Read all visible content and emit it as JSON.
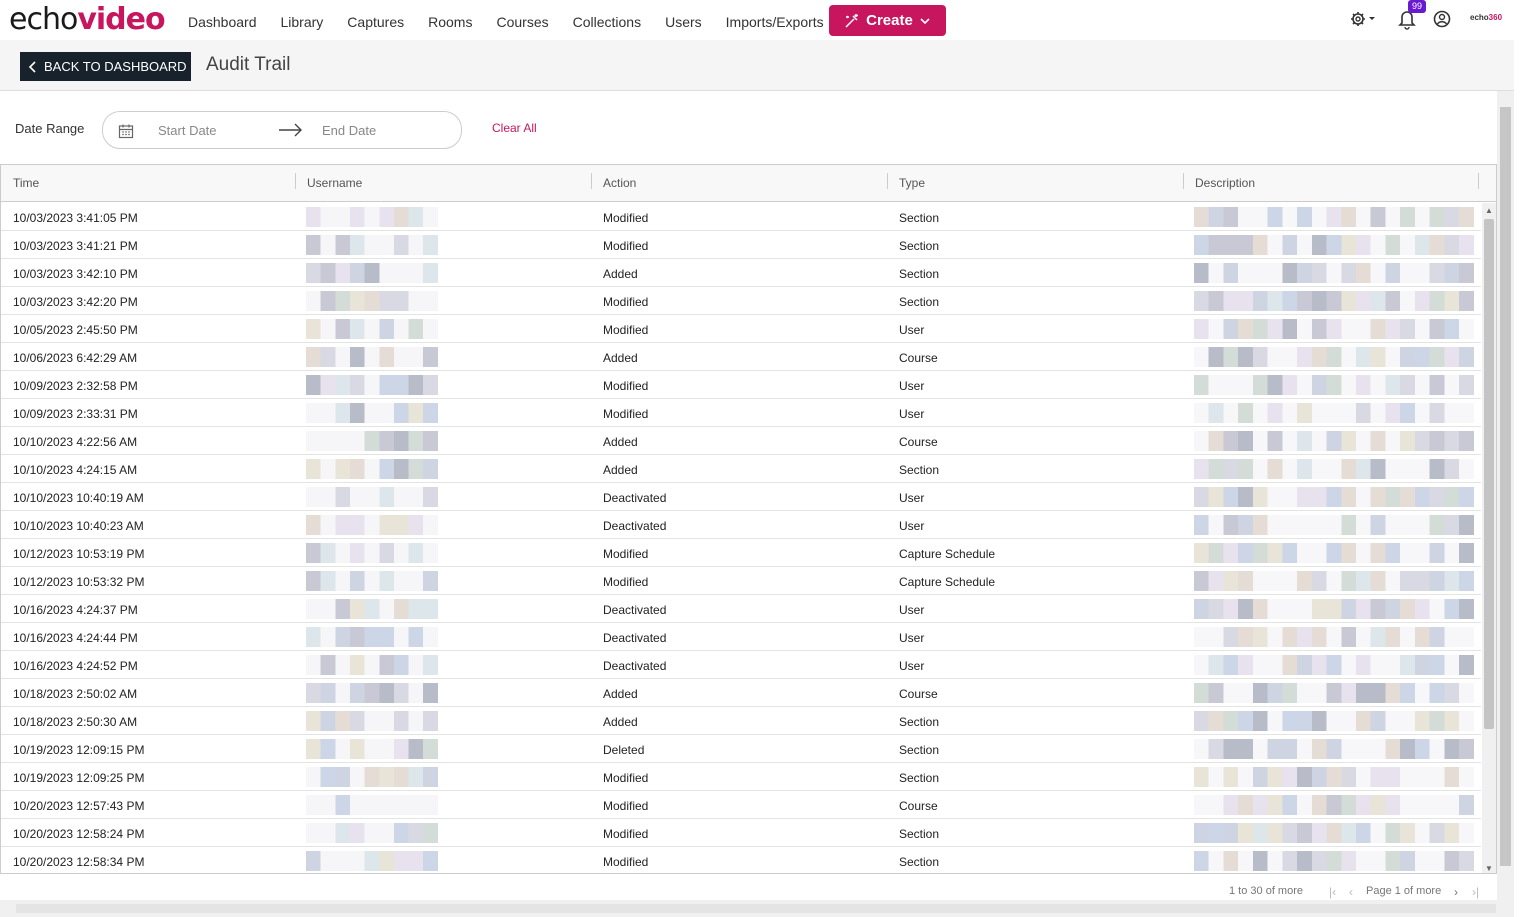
{
  "brand": {
    "echo": "echo",
    "video": "video",
    "echo360_a": "echo",
    "echo360_b": "360"
  },
  "nav": {
    "items": [
      "Dashboard",
      "Library",
      "Captures",
      "Rooms",
      "Courses",
      "Collections",
      "Users",
      "Imports/Exports"
    ],
    "create_label": "Create",
    "notification_count": "99"
  },
  "subheader": {
    "back_label": "BACK TO DASHBOARD",
    "title": "Audit Trail"
  },
  "filter": {
    "label": "Date Range",
    "start_placeholder": "Start Date",
    "end_placeholder": "End Date",
    "clear_label": "Clear All"
  },
  "table": {
    "columns": [
      "Time",
      "Username",
      "Action",
      "Type",
      "Description"
    ],
    "rows": [
      {
        "time": "10/03/2023 3:41:05 PM",
        "action": "Modified",
        "type": "Section"
      },
      {
        "time": "10/03/2023 3:41:21 PM",
        "action": "Modified",
        "type": "Section"
      },
      {
        "time": "10/03/2023 3:42:10 PM",
        "action": "Added",
        "type": "Section"
      },
      {
        "time": "10/03/2023 3:42:20 PM",
        "action": "Modified",
        "type": "Section"
      },
      {
        "time": "10/05/2023 2:45:50 PM",
        "action": "Modified",
        "type": "User"
      },
      {
        "time": "10/06/2023 6:42:29 AM",
        "action": "Added",
        "type": "Course"
      },
      {
        "time": "10/09/2023 2:32:58 PM",
        "action": "Modified",
        "type": "User"
      },
      {
        "time": "10/09/2023 2:33:31 PM",
        "action": "Modified",
        "type": "User"
      },
      {
        "time": "10/10/2023 4:22:56 AM",
        "action": "Added",
        "type": "Course"
      },
      {
        "time": "10/10/2023 4:24:15 AM",
        "action": "Added",
        "type": "Section"
      },
      {
        "time": "10/10/2023 10:40:19 AM",
        "action": "Deactivated",
        "type": "User"
      },
      {
        "time": "10/10/2023 10:40:23 AM",
        "action": "Deactivated",
        "type": "User"
      },
      {
        "time": "10/12/2023 10:53:19 PM",
        "action": "Modified",
        "type": "Capture Schedule"
      },
      {
        "time": "10/12/2023 10:53:32 PM",
        "action": "Modified",
        "type": "Capture Schedule"
      },
      {
        "time": "10/16/2023 4:24:37 PM",
        "action": "Deactivated",
        "type": "User"
      },
      {
        "time": "10/16/2023 4:24:44 PM",
        "action": "Deactivated",
        "type": "User"
      },
      {
        "time": "10/16/2023 4:24:52 PM",
        "action": "Deactivated",
        "type": "User"
      },
      {
        "time": "10/18/2023 2:50:02 AM",
        "action": "Added",
        "type": "Course"
      },
      {
        "time": "10/18/2023 2:50:30 AM",
        "action": "Added",
        "type": "Section"
      },
      {
        "time": "10/19/2023 12:09:15 PM",
        "action": "Deleted",
        "type": "Section"
      },
      {
        "time": "10/19/2023 12:09:25 PM",
        "action": "Modified",
        "type": "Section"
      },
      {
        "time": "10/20/2023 12:57:43 PM",
        "action": "Modified",
        "type": "Course"
      },
      {
        "time": "10/20/2023 12:58:24 PM",
        "action": "Modified",
        "type": "Section"
      },
      {
        "time": "10/20/2023 12:58:34 PM",
        "action": "Modified",
        "type": "Section"
      }
    ]
  },
  "pager": {
    "range": "1 to 30 of more",
    "page": "Page 1 of more"
  },
  "colors": {
    "accent": "#c8165e",
    "back_button": "#17222c",
    "badge": "#6a1bd1"
  }
}
